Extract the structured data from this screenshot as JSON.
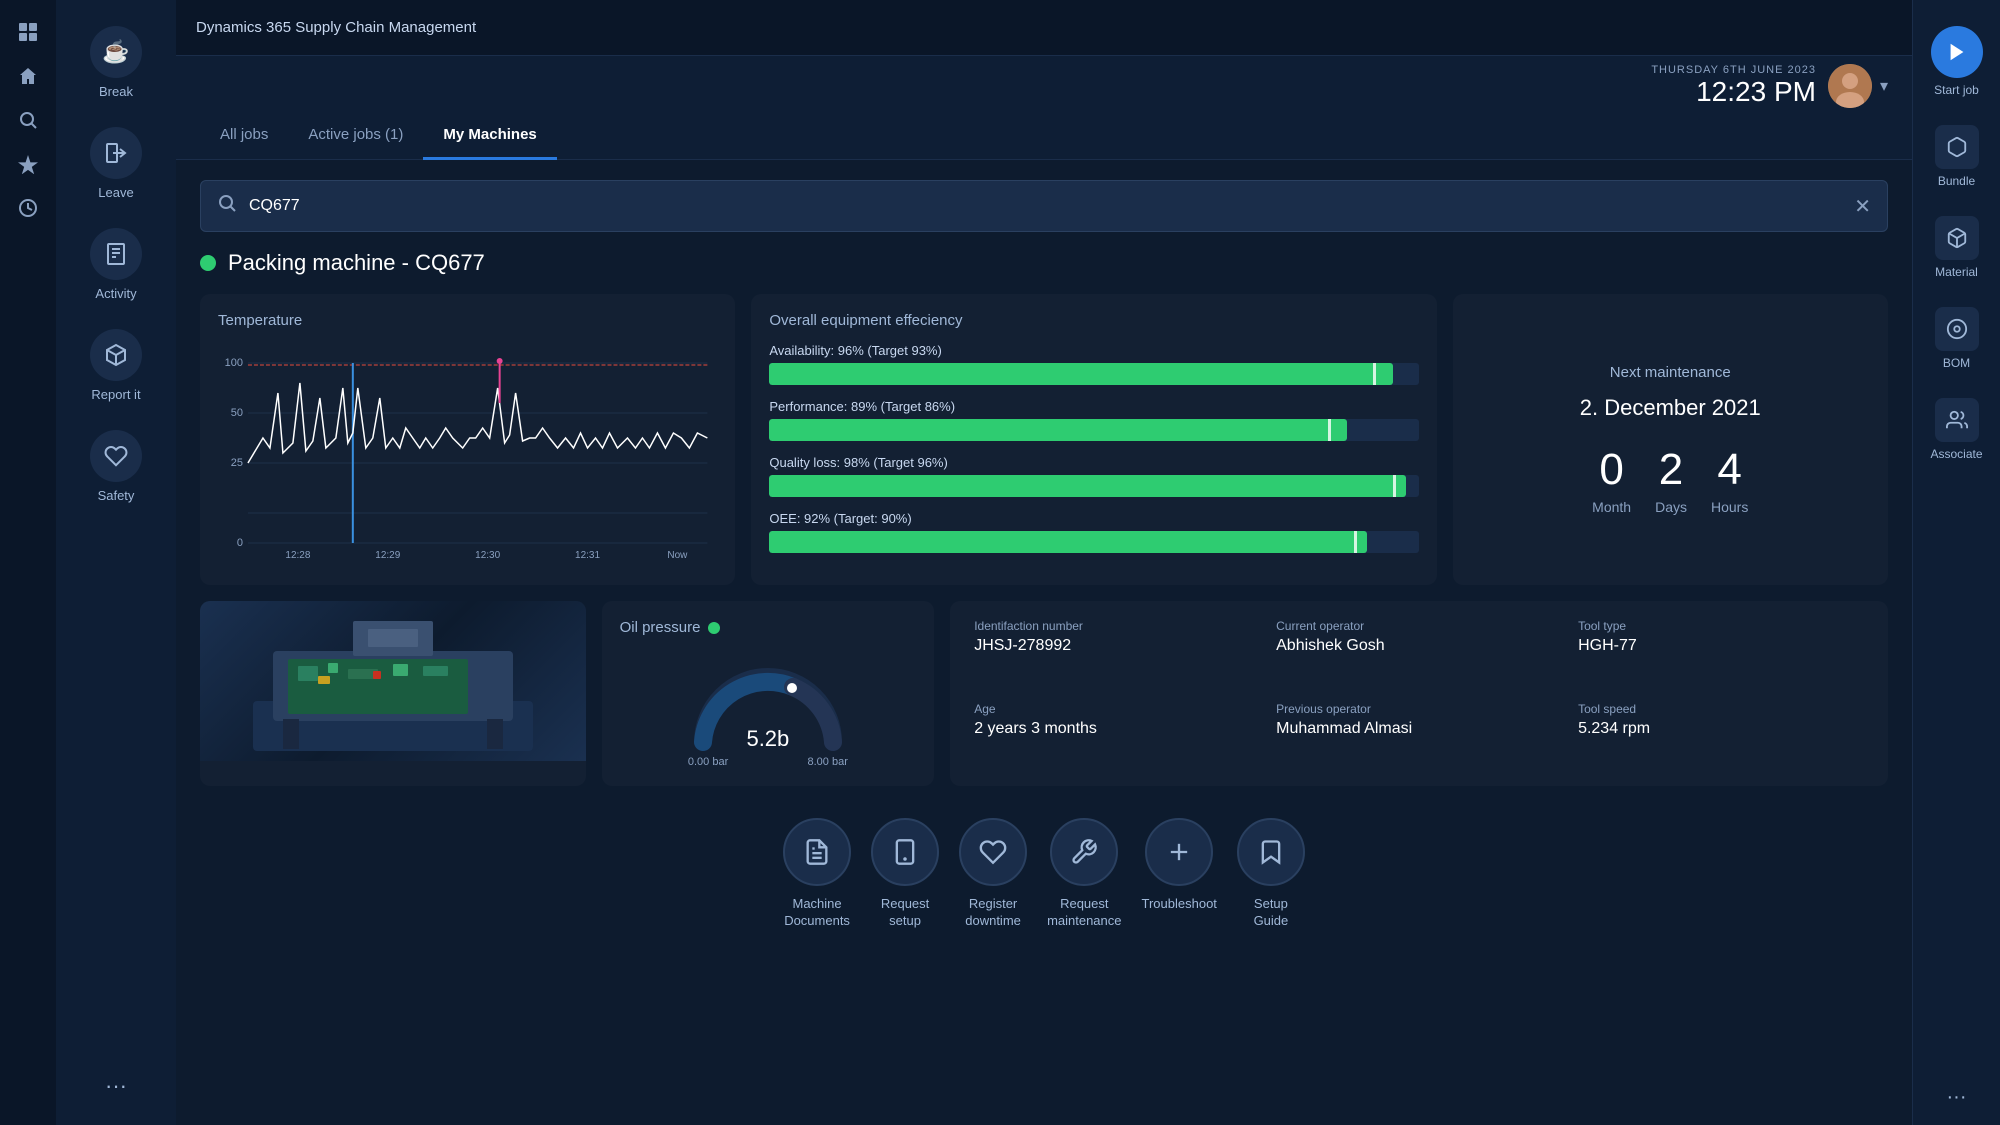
{
  "app": {
    "title": "Dynamics 365 Supply Chain Management"
  },
  "topbar": {
    "menu_icon": "≡",
    "grid_icon": "⊞"
  },
  "header": {
    "date": "THURSDAY 6th JUNE 2023",
    "time": "12:23 PM",
    "tabs": [
      {
        "id": "all-jobs",
        "label": "All jobs",
        "active": false
      },
      {
        "id": "active-jobs",
        "label": "Active jobs (1)",
        "active": false
      },
      {
        "id": "my-machines",
        "label": "My Machines",
        "active": true
      }
    ]
  },
  "search": {
    "placeholder": "Search...",
    "value": "CQ677"
  },
  "machine": {
    "name": "Packing machine - CQ677",
    "status": "online",
    "id_number": "JHSJ-278992",
    "age": "2 years 3 months",
    "current_operator": "Abhishek Gosh",
    "previous_operator": "Muhammad Almasi",
    "tool_type": "HGH-77",
    "tool_speed": "5.234 rpm"
  },
  "temperature": {
    "title": "Temperature",
    "y_labels": [
      "100",
      "50",
      "25",
      "0"
    ],
    "x_labels": [
      "12:28",
      "12:29",
      "12:30",
      "12:31",
      "Now"
    ]
  },
  "oee": {
    "title": "Overall equipment effeciency",
    "metrics": [
      {
        "label": "Availability: 96%  (Target 93%)",
        "value": 96,
        "target": 93
      },
      {
        "label": "Performance: 89%  (Target 86%)",
        "value": 89,
        "target": 86
      },
      {
        "label": "Quality loss: 98%  (Target 96%)",
        "value": 98,
        "target": 96
      },
      {
        "label": "OEE: 92%  (Target: 90%)",
        "value": 92,
        "target": 90
      }
    ]
  },
  "maintenance": {
    "title": "Next maintenance",
    "date": "2. December 2021",
    "months": "0",
    "days": "2",
    "hours": "4",
    "month_label": "Month",
    "days_label": "Days",
    "hours_label": "Hours"
  },
  "oil_pressure": {
    "title": "Oil pressure",
    "value": "5.2b",
    "min": "0.00 bar",
    "max": "8.00 bar",
    "status": "normal"
  },
  "sidebar": {
    "items": [
      {
        "id": "break",
        "label": "Break",
        "icon": "☕"
      },
      {
        "id": "leave",
        "label": "Leave",
        "icon": "🚪"
      },
      {
        "id": "activity",
        "label": "Activity",
        "icon": "📋"
      },
      {
        "id": "report-it",
        "label": "Report it",
        "icon": "📌"
      },
      {
        "id": "safety",
        "label": "Safety",
        "icon": "❤"
      }
    ],
    "more": "..."
  },
  "right_sidebar": {
    "items": [
      {
        "id": "start-job",
        "label": "Start job",
        "icon": "▶"
      },
      {
        "id": "bundle",
        "label": "Bundle",
        "icon": "⬡"
      },
      {
        "id": "material",
        "label": "Material",
        "icon": "⬡"
      },
      {
        "id": "bom",
        "label": "BOM",
        "icon": "◉"
      },
      {
        "id": "associate",
        "label": "Associate",
        "icon": "👤"
      }
    ],
    "more": "..."
  },
  "actions": [
    {
      "id": "machine-documents",
      "label": "Machine\nDocuments",
      "icon": "📄"
    },
    {
      "id": "request-setup",
      "label": "Request\nsetup",
      "icon": "📱"
    },
    {
      "id": "register-downtime",
      "label": "Register\ndowntime",
      "icon": "❤"
    },
    {
      "id": "request-maintenance",
      "label": "Request\nmaintenance",
      "icon": "🔧"
    },
    {
      "id": "troubleshoot",
      "label": "Troubleshoot",
      "icon": "✛"
    },
    {
      "id": "setup-guide",
      "label": "Setup\nGuide",
      "icon": "🔖"
    }
  ]
}
